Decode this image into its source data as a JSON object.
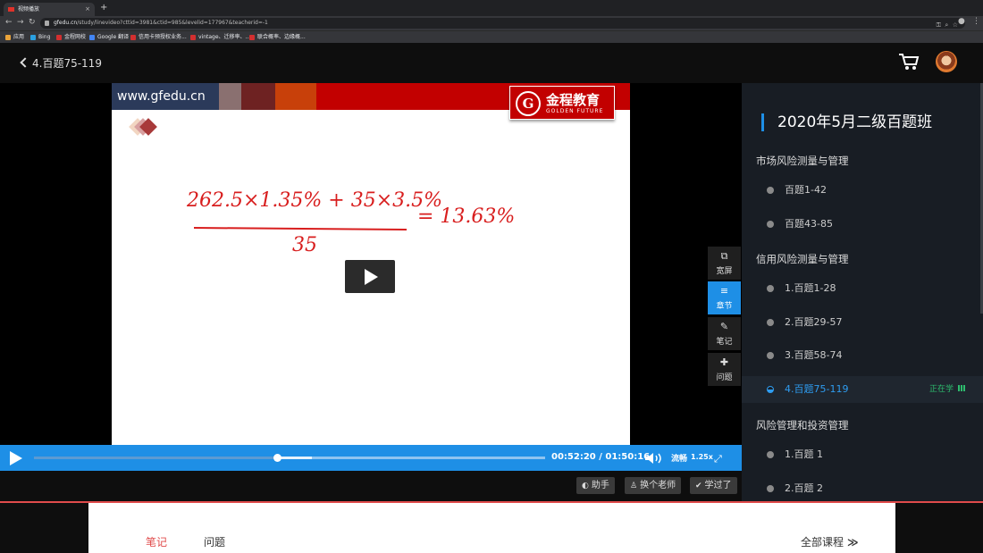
{
  "browser": {
    "tab_title": "视频播放",
    "tab_close": "×",
    "new_tab": "+",
    "url_host": "gfedu.cn",
    "url_path": "/study/linevideo?cttid=3981&ctid=985&levelid=177967&teacherid=-1",
    "bookmarks": [
      {
        "label": "应用",
        "color": "#e8a33a"
      },
      {
        "label": "Bing",
        "color": "#2aa0e0"
      },
      {
        "label": "金程网校",
        "color": "#d32f2f"
      },
      {
        "label": "Google 翻译",
        "color": "#4285f4"
      },
      {
        "label": "信用卡预授权业务...",
        "color": "#d32f2f"
      },
      {
        "label": "vintage、迁移率、...",
        "color": "#d32f2f"
      },
      {
        "label": "联合概率、边缘概...",
        "color": "#d32f2f"
      }
    ]
  },
  "header": {
    "back_title": "4.百题75-119"
  },
  "player": {
    "slide_site": "www.gfedu.cn",
    "logo_cn": "金程教育",
    "logo_en": "GOLDEN FUTURE",
    "logo_seal": "G",
    "formula_numerator": "262.5×1.35% + 35×3.5%",
    "formula_denominator": "35",
    "formula_result": "= 13.63%",
    "time_current": "00:52:20",
    "time_sep": "/",
    "time_total": "01:50:16",
    "quality": "流畅",
    "speed": "1.25x",
    "progress_fraction": 0.475,
    "buffered_fraction": 0.544
  },
  "side_tools": [
    {
      "label": "宽屏",
      "icon": "widescreen-icon",
      "glyph": "⧉",
      "active": false
    },
    {
      "label": "章节",
      "icon": "chapter-list-icon",
      "glyph": "≡",
      "active": true
    },
    {
      "label": "笔记",
      "icon": "pencil-icon",
      "glyph": "✎",
      "active": false
    },
    {
      "label": "问题",
      "icon": "question-icon",
      "glyph": "✚",
      "active": false
    }
  ],
  "below_buttons": [
    {
      "label": "助手",
      "icon": "chat-icon",
      "glyph": "💬"
    },
    {
      "label": "换个老师",
      "icon": "user-icon",
      "glyph": "👤"
    },
    {
      "label": "学过了",
      "icon": "check-icon",
      "glyph": "✔"
    }
  ],
  "sidebar": {
    "title": "2020年5月二级百题班",
    "sections": [
      {
        "title": "市场风险测量与管理",
        "items": [
          "百题1-42",
          "百题43-85"
        ]
      },
      {
        "title": "信用风险测量与管理",
        "items": [
          "1.百题1-28",
          "2.百题29-57",
          "3.百题58-74",
          "4.百题75-119"
        ]
      },
      {
        "title": "风险管理和投资管理",
        "items": [
          "1.百题 1",
          "2.百题 2"
        ]
      }
    ],
    "current_status": "正在学"
  },
  "bottom": {
    "tabs": [
      "笔记",
      "问题"
    ],
    "all_courses": "全部课程"
  },
  "colors": {
    "accent": "#1e8fe6",
    "brand_red": "#c20000",
    "active_tab": "#e04b4b",
    "status_green": "#2dbd6e"
  }
}
